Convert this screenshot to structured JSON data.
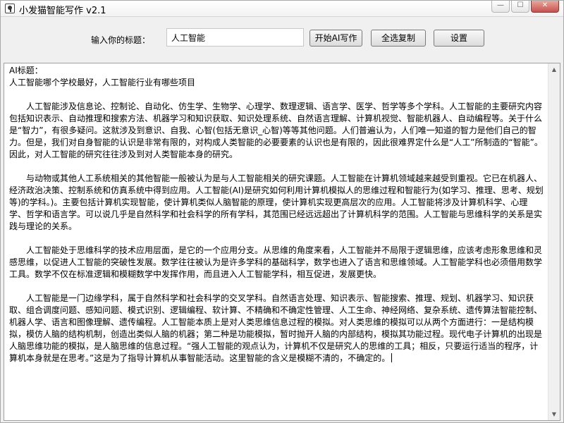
{
  "window": {
    "title": "小发猫智能写作 v2.1",
    "minimize_glyph": "—",
    "maximize_glyph": "☐",
    "close_glyph": "✕"
  },
  "toolbar": {
    "title_label": "输入你的标题：",
    "title_value": "人工智能",
    "start_label": "开始AI写作",
    "copy_all_label": "全选复制",
    "settings_label": "设置"
  },
  "content": {
    "heading": "AI标题：",
    "article_title": "人工智能哪个学校最好，人工智能行业有哪些项目",
    "paragraphs": [
      "人工智能涉及信息论、控制论、自动化、仿生学、生物学、心理学、数理逻辑、语言学、医学、哲学等多个学科。人工智能的主要研究内容包括知识表示、自动推理和搜索方法、机器学习和知识获取、知识处理系统、自然语言理解、计算机视觉、智能机器人、自动编程等。关于什么是“智力”，有很多疑问。这就涉及到意识、自我、心智(包括无意识_心智)等等其他问题。人们普遍认为，人们唯一知道的智力是他们自己的智力。但是，我们对自身智能的认识是非常有限的，对构成人类智能的必要要素的认识也是有限的，因此很难界定什么是“人工”所制造的“智能”。因此，对人工智能的研究往往涉及到对人类智能本身的研究。",
      "与动物或其他人工系统相关的其他智能一般被认为是与人工智能相关的研究课题。人工智能在计算机领域越来越受到重视。它已在机器人、经济政治决策、控制系统和仿真系统中得到应用。人工智能(AI)是研究如何利用计算机模拟人的思维过程和智能行为(如学习、推理、思考、规划等)的学科。)。主要包括计算机实现智能，使计算机类似人脑智能的原理，使计算机实现更高层次的应用。人工智能将涉及计算机科学、心理学、哲学和语言学。可以说几乎是自然科学和社会科学的所有学科，其范围已经远远超出了计算机科学的范围。人工智能与思维科学的关系是实践与理论的关系。",
      "人工智能处于思维科学的技术应用层面，是它的一个应用分支。从思维的角度来看，人工智能并不局限于逻辑思维，应该考虑形象思维和灵感思维，以促进人工智能的突破性发展。数学往往被认为是许多学科的基础科学，数学也进入了语言和思维领域。人工智能学科也必须借用数学工具。数学不仅在标准逻辑和模糊数学中发挥作用，而且进入人工智能学科，相互促进，发展更快。",
      "人工智能是一门边缘学科，属于自然科学和社会科学的交叉学科。自然语言处理、知识表示、智能搜索、推理、规划、机器学习、知识获取、组合调度问题、感知问题、模式识别、逻辑编程、软计算、不精确和不确定性管理、人工生命、神经网络、复杂系统、遗传算法智能控制、机器人学、语言和图像理解、遗传编程。人工智能本质上是对人类思维信息过程的模拟。对人类思维的模拟可以从两个方面进行：一是结构模拟，模仿人脑的结构机制，创造出类似人脑的机器；第二种是功能模拟，暂时抛开人脑的内部结构，模拟其功能过程。现代电子计算机的出现是人脑思维功能的模拟，是人脑思维的信息过程。“强人工智能的观点认为，计算机不仅是研究人的思维的工具；相反，只要运行适当的程序，计算机本身就是在思考。”这是为了指导计算机从事智能活动。这里智能的含义是模糊不清的，不确定的。"
    ]
  },
  "icons": {
    "scroll_up": "▲",
    "scroll_down": "▼"
  },
  "colors": {
    "window_bg": "#f0f0f0",
    "content_bg": "#ffffff",
    "close_button": "#c75050"
  }
}
